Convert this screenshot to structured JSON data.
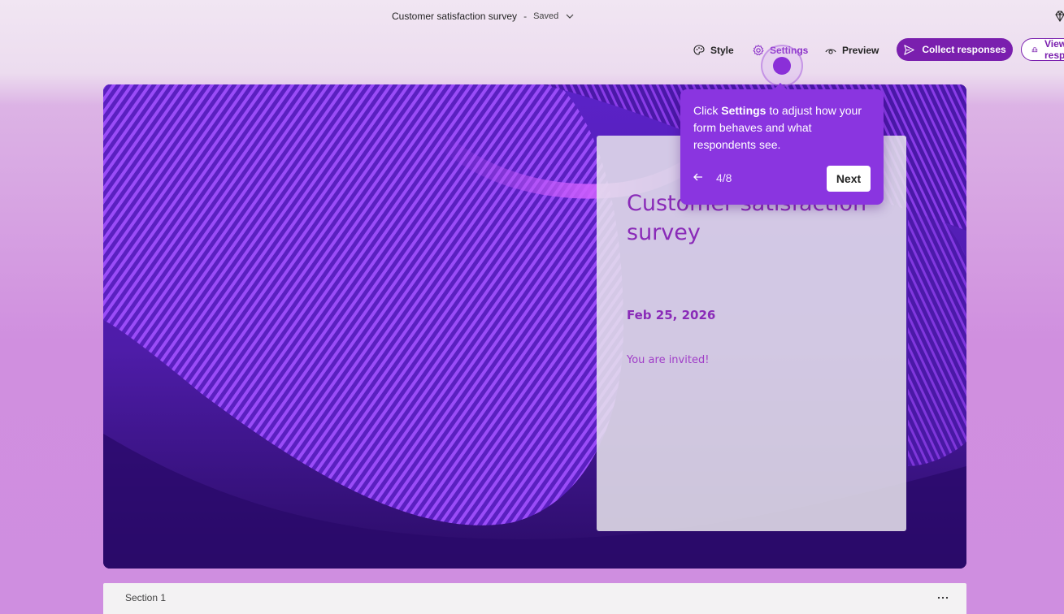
{
  "header": {
    "doc_title": "Customer satisfaction survey",
    "separator": "-",
    "save_status": "Saved"
  },
  "commands": {
    "style_label": "Style",
    "settings_label": "Settings",
    "preview_label": "Preview",
    "collect_label": "Collect responses",
    "view_label": "View responses"
  },
  "tooltip": {
    "text_before": "Click ",
    "text_bold": "Settings",
    "text_after": " to adjust how your form behaves and what respondents see.",
    "step": "4/8",
    "next_label": "Next"
  },
  "form": {
    "title": "Customer satisfaction survey",
    "date": "Feb 25, 2026",
    "description": "You are invited!"
  },
  "section": {
    "label": "Section 1"
  },
  "colors": {
    "accent": "#7a1fae",
    "tooltip_bg": "#8a35e0",
    "title_text": "#8a2bb8"
  },
  "icons": [
    "chevron-down-icon",
    "diamond-icon",
    "palette-icon",
    "gear-icon",
    "eye-icon",
    "send-icon",
    "chart-icon",
    "arrow-left-icon",
    "more-icon"
  ]
}
